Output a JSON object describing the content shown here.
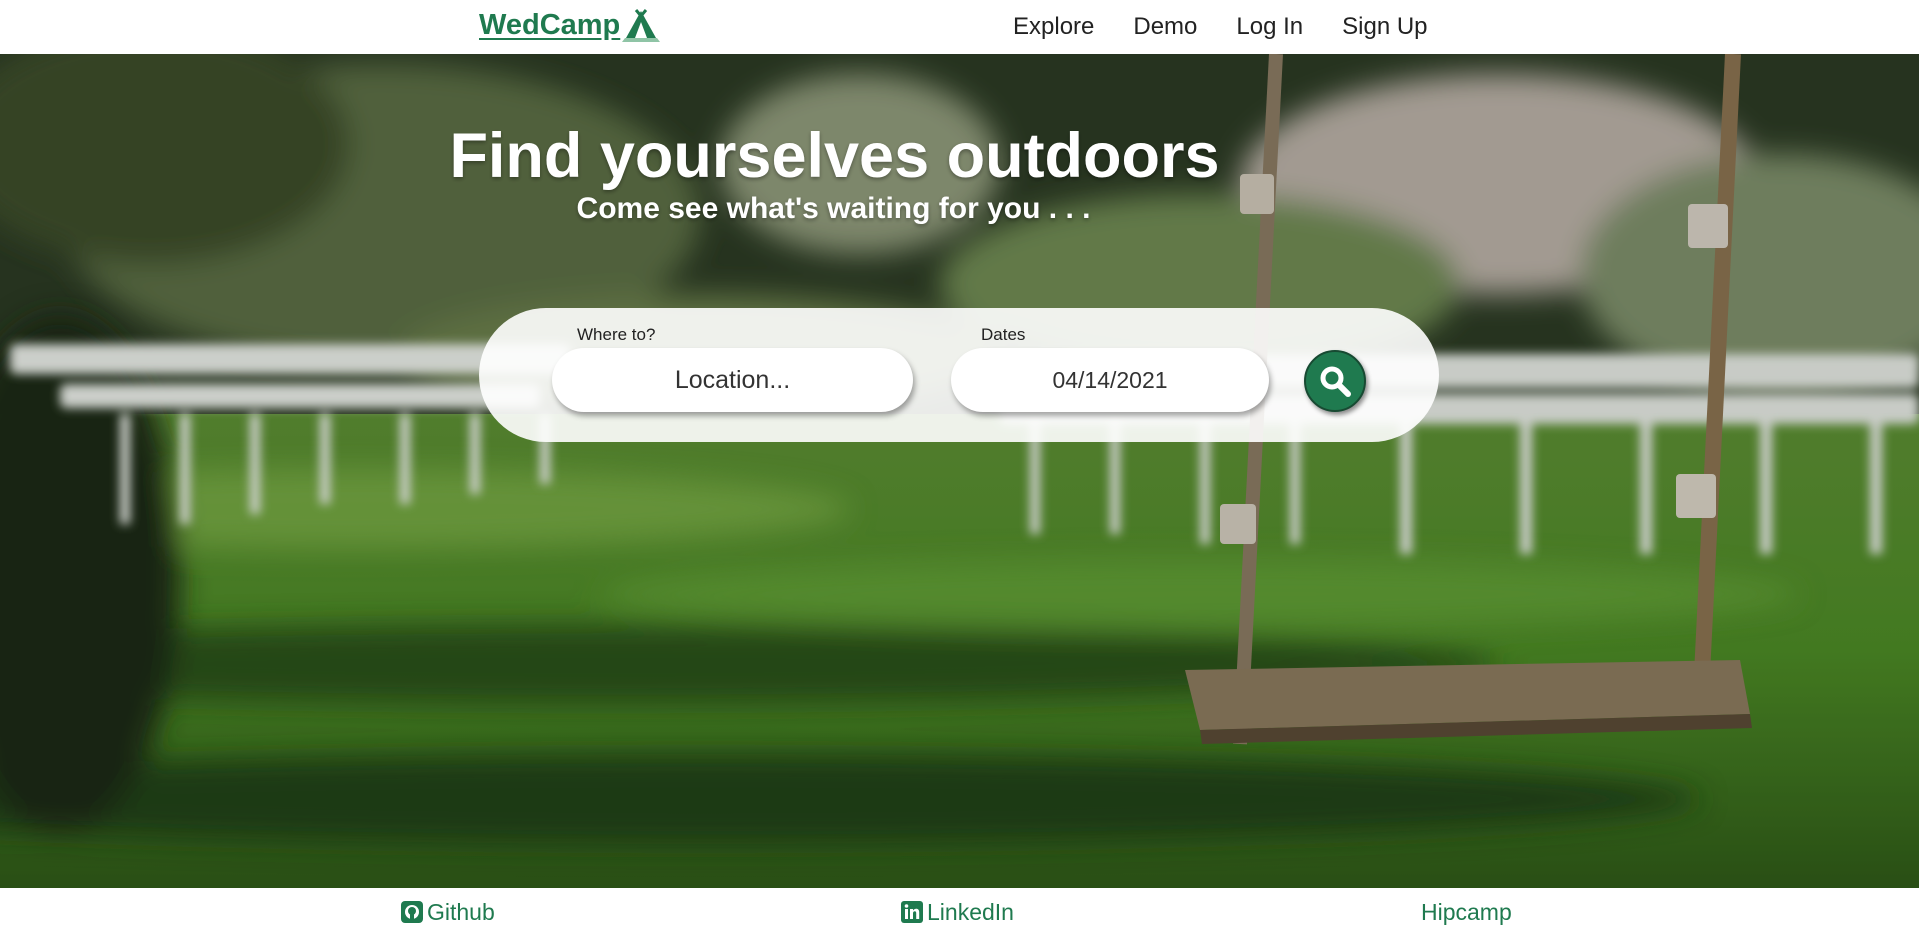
{
  "nav": {
    "logo_text": "WedCamp",
    "links": [
      "Explore",
      "Demo",
      "Log In",
      "Sign Up"
    ]
  },
  "hero": {
    "title": "Find yourselves outdoors",
    "subtitle": "Come see what's waiting for you . . ."
  },
  "search": {
    "location_label": "Where to?",
    "location_placeholder": "Location...",
    "dates_label": "Dates",
    "date_value": "04/14/2021",
    "button_icon": "magnifier-icon"
  },
  "footer": {
    "links": [
      {
        "label": "Github",
        "icon": "github-icon"
      },
      {
        "label": "LinkedIn",
        "icon": "linkedin-icon"
      },
      {
        "label": "Hipcamp"
      }
    ]
  },
  "colors": {
    "brand_green": "#1f7a4f",
    "white": "#ffffff"
  }
}
